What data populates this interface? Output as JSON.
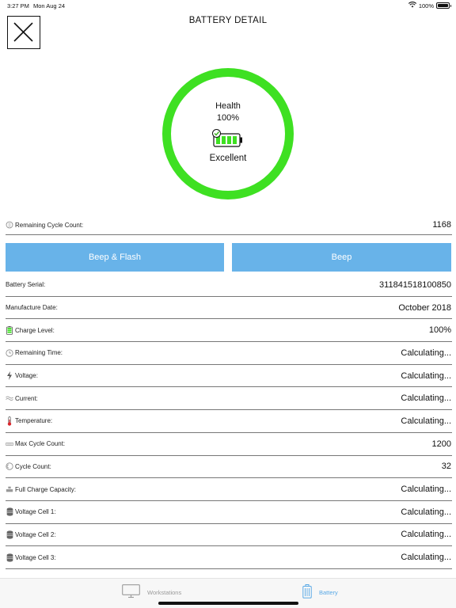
{
  "status_bar": {
    "time": "3:27 PM",
    "date": "Mon Aug 24",
    "battery_percent": "100%"
  },
  "header": {
    "title": "BATTERY DETAIL"
  },
  "health": {
    "label": "Health",
    "value": "100%",
    "rating": "Excellent",
    "ring_color": "#3ee022",
    "ring_fraction": 1.0
  },
  "remaining_cycles": {
    "label": "Remaining Cycle Count:",
    "value": "1168"
  },
  "actions": {
    "beep_flash": "Beep & Flash",
    "beep": "Beep",
    "button_color": "#68b3e9"
  },
  "details": [
    {
      "label": "Battery Serial:",
      "value": "311841518100850",
      "icon": ""
    },
    {
      "label": "Manufacture Date:",
      "value": "October 2018",
      "icon": ""
    },
    {
      "label": "Charge Level:",
      "value": "100%",
      "icon": "charge-level-icon"
    },
    {
      "label": "Remaining Time:",
      "value": "Calculating...",
      "icon": "clock-icon"
    },
    {
      "label": "Voltage:",
      "value": "Calculating...",
      "icon": "lightning-icon"
    },
    {
      "label": "Current:",
      "value": "Calculating...",
      "icon": "wave-icon"
    },
    {
      "label": "Temperature:",
      "value": "Calculating...",
      "icon": "thermometer-icon"
    },
    {
      "label": "Max Cycle Count:",
      "value": "1200",
      "icon": "cycle-bar-icon"
    },
    {
      "label": "Cycle Count:",
      "value": "32",
      "icon": "cycle-icon"
    },
    {
      "label": "Full Charge Capacity:",
      "value": "Calculating...",
      "icon": "capacity-icon"
    },
    {
      "label": "Voltage Cell 1:",
      "value": "Calculating...",
      "icon": "cell-icon"
    },
    {
      "label": "Voltage Cell 2:",
      "value": "Calculating...",
      "icon": "cell-icon"
    },
    {
      "label": "Voltage Cell 3:",
      "value": "Calculating...",
      "icon": "cell-icon"
    }
  ],
  "tab_bar": {
    "workstations": {
      "label": "Workstations",
      "icon": "monitor-icon",
      "color": "#9a9a9a"
    },
    "battery": {
      "label": "Battery",
      "icon": "battery-tab-icon",
      "color": "#5aa9e6"
    }
  }
}
